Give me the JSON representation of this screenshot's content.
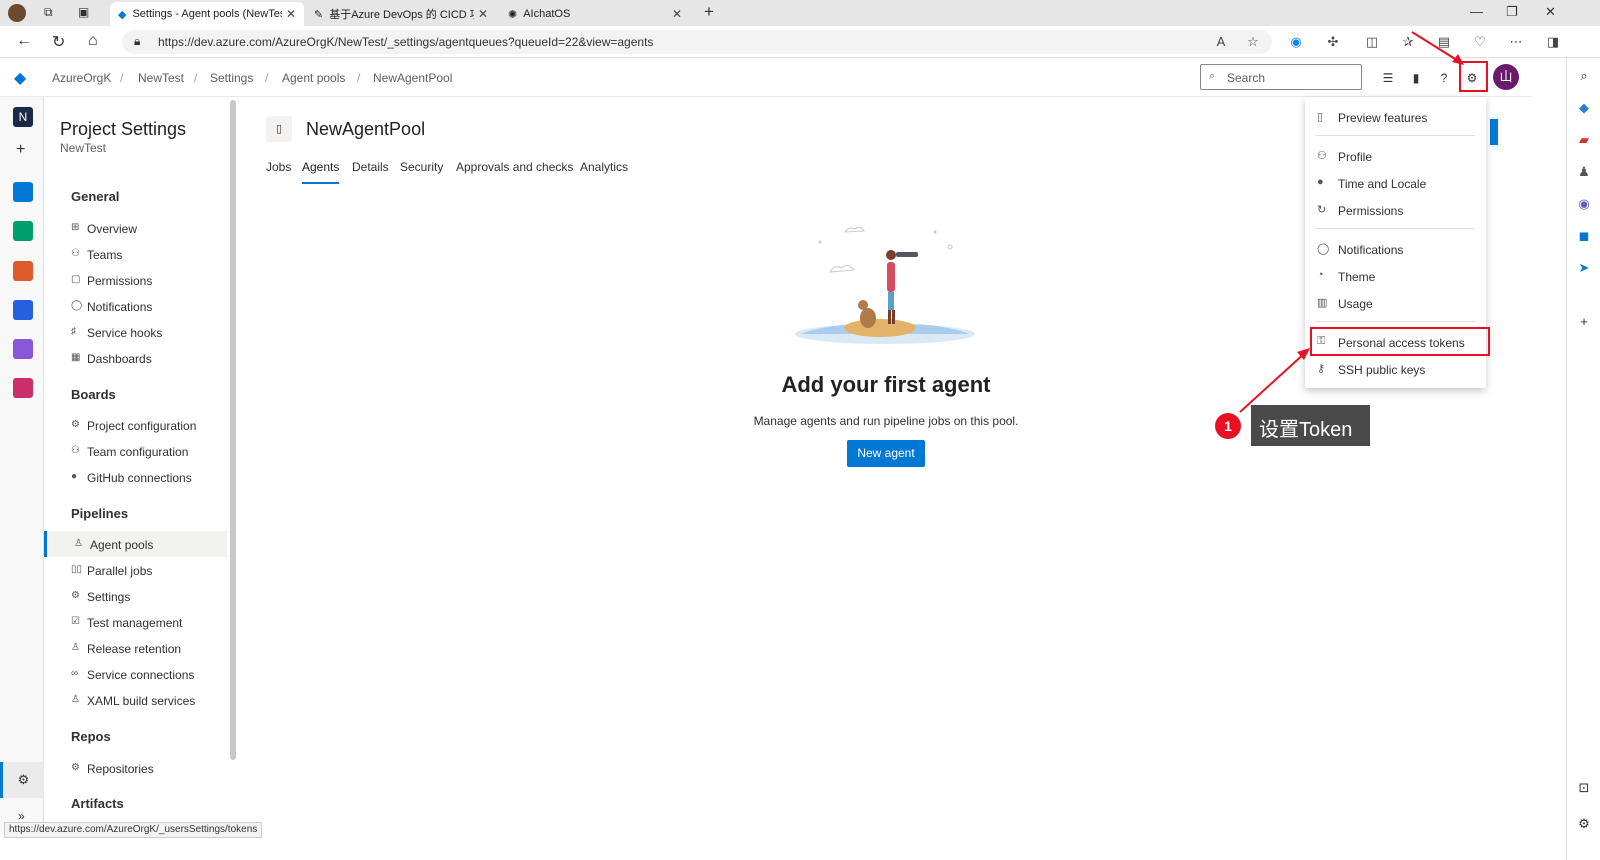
{
  "browser": {
    "tabs": [
      {
        "label": "Settings - Agent pools (NewTest)"
      },
      {
        "label": "基于Azure DevOps 的 CICD 项目"
      },
      {
        "label": "AIchatOS"
      }
    ],
    "url": "https://dev.azure.com/AzureOrgK/NewTest/_settings/agentqueues?queueId=22&view=agents",
    "status_url": "https://dev.azure.com/AzureOrgK/_usersSettings/tokens"
  },
  "header": {
    "breadcrumb": [
      "AzureOrgK",
      "NewTest",
      "Settings",
      "Agent pools",
      "NewAgentPool"
    ],
    "search_placeholder": "Search",
    "avatar_initial": "山"
  },
  "sidebar": {
    "title": "Project Settings",
    "subtitle": "NewTest",
    "sections": [
      {
        "title": "General",
        "items": [
          "Overview",
          "Teams",
          "Permissions",
          "Notifications",
          "Service hooks",
          "Dashboards"
        ]
      },
      {
        "title": "Boards",
        "items": [
          "Project configuration",
          "Team configuration",
          "GitHub connections"
        ]
      },
      {
        "title": "Pipelines",
        "items": [
          "Agent pools",
          "Parallel jobs",
          "Settings",
          "Test management",
          "Release retention",
          "Service connections",
          "XAML build services"
        ]
      },
      {
        "title": "Repos",
        "items": [
          "Repositories"
        ]
      },
      {
        "title": "Artifacts",
        "items": []
      }
    ],
    "selected": "Agent pools"
  },
  "main": {
    "pool_title": "NewAgentPool",
    "tabs": [
      "Jobs",
      "Agents",
      "Details",
      "Security",
      "Approvals and checks",
      "Analytics"
    ],
    "selected_tab": "Agents",
    "empty_title": "Add your first agent",
    "empty_desc": "Manage agents and run pipeline jobs on this pool.",
    "new_agent_label": "New agent"
  },
  "user_menu": {
    "items": [
      "Preview features",
      "Profile",
      "Time and Locale",
      "Permissions",
      "Notifications",
      "Theme",
      "Usage",
      "Personal access tokens",
      "SSH public keys"
    ],
    "highlighted": "Personal access tokens"
  },
  "annotation": {
    "number": "1",
    "text": "设置Token"
  },
  "colors": {
    "accent": "#0078d4",
    "annotation_red": "#e81123"
  }
}
